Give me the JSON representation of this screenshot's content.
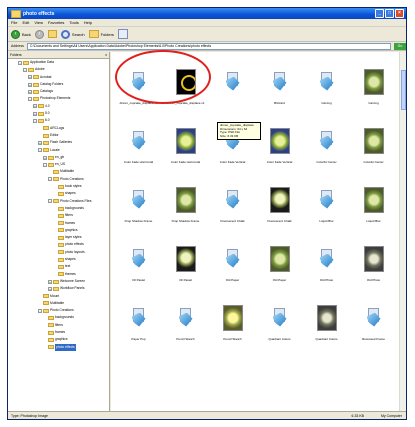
{
  "window": {
    "title": "photo effects"
  },
  "menu": [
    "File",
    "Edit",
    "View",
    "Favorites",
    "Tools",
    "Help"
  ],
  "toolbar": {
    "back": "Back",
    "search": "Search",
    "folders": "Folders"
  },
  "address": {
    "label": "Address",
    "path": "C:\\Documents and Settings\\All Users\\Application Data\\Adobe\\Photoshop Elements\\6.0\\Photo Creations\\photo effects",
    "go": "Go"
  },
  "folders_pane": {
    "title": "Folders",
    "close": "x"
  },
  "tree": [
    {
      "label": "Application Data",
      "indent": 2,
      "pm": "-"
    },
    {
      "label": "Adobe",
      "indent": 3,
      "pm": "-"
    },
    {
      "label": "Acrobat",
      "indent": 4,
      "pm": "+"
    },
    {
      "label": "Catalog Folders",
      "indent": 4,
      "pm": "+"
    },
    {
      "label": "Catalogs",
      "indent": 4,
      "pm": "+"
    },
    {
      "label": "Photoshop Elements",
      "indent": 4,
      "pm": "-"
    },
    {
      "label": "4.0",
      "indent": 5,
      "pm": "+"
    },
    {
      "label": "5.0",
      "indent": 5,
      "pm": "+"
    },
    {
      "label": "6.0",
      "indent": 5,
      "pm": "-"
    },
    {
      "label": "ARCLogs",
      "indent": 6,
      "pm": ""
    },
    {
      "label": "Editor",
      "indent": 6,
      "pm": ""
    },
    {
      "label": "Flash Galleries",
      "indent": 6,
      "pm": "+"
    },
    {
      "label": "Locale",
      "indent": 6,
      "pm": "-"
    },
    {
      "label": "en_gb",
      "indent": 7,
      "pm": "+"
    },
    {
      "label": "en_US",
      "indent": 7,
      "pm": "-"
    },
    {
      "label": "Multitable",
      "indent": 8,
      "pm": ""
    },
    {
      "label": "Photo Creations",
      "indent": 8,
      "pm": "-"
    },
    {
      "label": "book styles",
      "indent": 9,
      "pm": ""
    },
    {
      "label": "shapes",
      "indent": 9,
      "pm": ""
    },
    {
      "label": "Photo Creations Files",
      "indent": 8,
      "pm": "-"
    },
    {
      "label": "backgrounds",
      "indent": 9,
      "pm": ""
    },
    {
      "label": "filters",
      "indent": 9,
      "pm": ""
    },
    {
      "label": "frames",
      "indent": 9,
      "pm": ""
    },
    {
      "label": "graphics",
      "indent": 9,
      "pm": ""
    },
    {
      "label": "layer styles",
      "indent": 9,
      "pm": ""
    },
    {
      "label": "photo effects",
      "indent": 9,
      "pm": ""
    },
    {
      "label": "photo layouts",
      "indent": 9,
      "pm": ""
    },
    {
      "label": "shapes",
      "indent": 9,
      "pm": ""
    },
    {
      "label": "text",
      "indent": 9,
      "pm": ""
    },
    {
      "label": "themes",
      "indent": 9,
      "pm": ""
    },
    {
      "label": "Welcome Screen",
      "indent": 8,
      "pm": "+"
    },
    {
      "label": "Workflow Panels",
      "indent": 8,
      "pm": "+"
    },
    {
      "label": "Mount",
      "indent": 6,
      "pm": ""
    },
    {
      "label": "Multitable",
      "indent": 6,
      "pm": ""
    },
    {
      "label": "Photo Creations",
      "indent": 6,
      "pm": "-"
    },
    {
      "label": "backgrounds",
      "indent": 7,
      "pm": ""
    },
    {
      "label": "filters",
      "indent": 7,
      "pm": ""
    },
    {
      "label": "frames",
      "indent": 7,
      "pm": ""
    },
    {
      "label": "graphics",
      "indent": 7,
      "pm": ""
    },
    {
      "label": "photo effects",
      "indent": 7,
      "pm": "",
      "selected": true
    }
  ],
  "items": [
    {
      "name": "dinner_cupcake_displace.v1",
      "kind": "fx"
    },
    {
      "name": "dinner_cupcake_displace.v1",
      "kind": "cupcake"
    },
    {
      "name": "",
      "kind": "fx"
    },
    {
      "name": "Blizzard",
      "kind": "fx"
    },
    {
      "name": "Carving",
      "kind": "fx"
    },
    {
      "name": "Carving",
      "kind": "olive"
    },
    {
      "name": "Color Fade Horizontal",
      "kind": "fx"
    },
    {
      "name": "Color Fade Horizontal",
      "kind": "blueb"
    },
    {
      "name": "Color Fade Vertical",
      "kind": "fx"
    },
    {
      "name": "Color Fade Vertical",
      "kind": "blueb"
    },
    {
      "name": "Colorful Center",
      "kind": "fx"
    },
    {
      "name": "Colorful Center",
      "kind": "olive"
    },
    {
      "name": "Drop Shadow Frame",
      "kind": "fx"
    },
    {
      "name": "Drop Shadow Frame",
      "kind": "olive"
    },
    {
      "name": "Fluorescent Chalk",
      "kind": "fx"
    },
    {
      "name": "Fluorescent Chalk",
      "kind": "dark"
    },
    {
      "name": "Liquid Blur",
      "kind": "fx"
    },
    {
      "name": "Liquid Blur",
      "kind": "olive"
    },
    {
      "name": "Oil Pastel",
      "kind": "fx"
    },
    {
      "name": "Oil Pastel",
      "kind": "dark"
    },
    {
      "name": "Old Paper",
      "kind": "fx"
    },
    {
      "name": "Old Paper",
      "kind": "olive"
    },
    {
      "name": "Old Photo",
      "kind": "fx"
    },
    {
      "name": "Old Photo",
      "kind": "grey"
    },
    {
      "name": "Paper Pop",
      "kind": "fx"
    },
    {
      "name": "Pencil Sketch",
      "kind": "fx"
    },
    {
      "name": "Pencil Sketch",
      "kind": "yellow"
    },
    {
      "name": "Quadrant Colors",
      "kind": "fx"
    },
    {
      "name": "Quadrant Colors",
      "kind": "grey"
    },
    {
      "name": "Recessed Frame",
      "kind": "fx"
    }
  ],
  "tooltip": {
    "line1": "dinner_cupcake_displace",
    "line2": "Dimensions: 64 x 64",
    "line3": "Type: PSD File",
    "line4": "Size: 6.33 KB"
  },
  "status": {
    "left": "Type: Photoshop Image",
    "size": "6.33 KB",
    "zone": "My Computer"
  }
}
